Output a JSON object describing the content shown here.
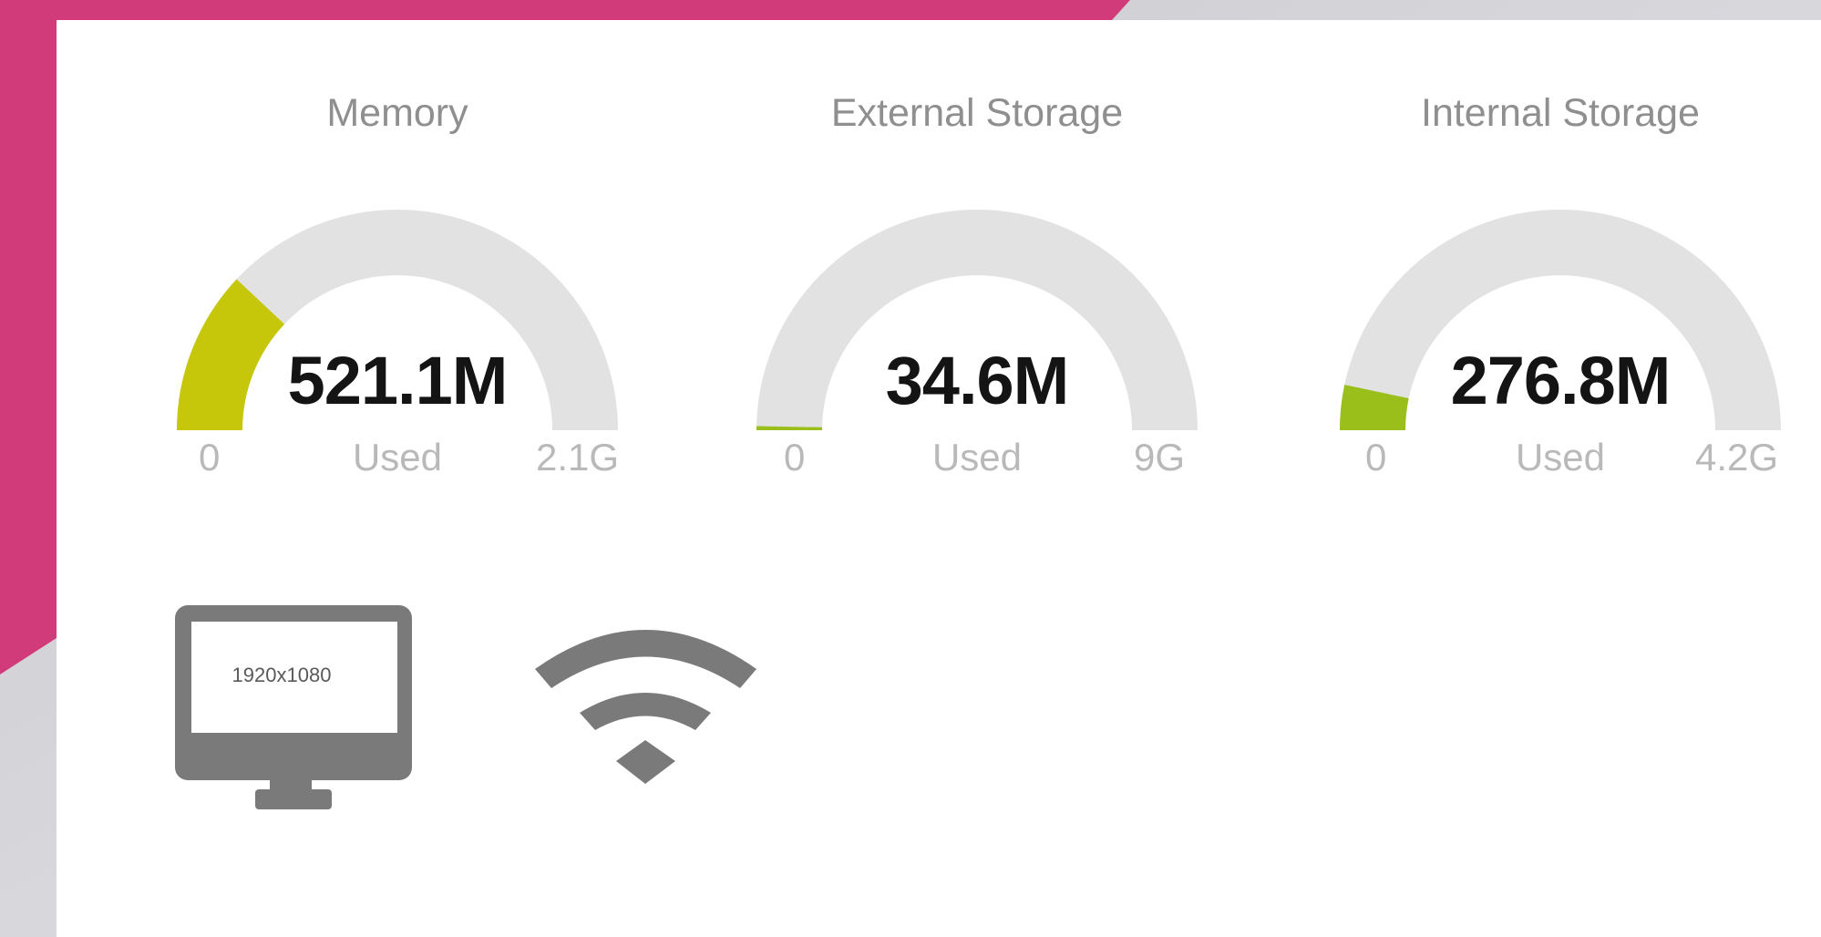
{
  "gauges": [
    {
      "title": "Memory",
      "value": "521.1M",
      "caption": "Used",
      "min": "0",
      "max": "2.1G",
      "fraction": 0.24,
      "fill_color": "#c6c60a"
    },
    {
      "title": "External Storage",
      "value": "34.6M",
      "caption": "Used",
      "min": "0",
      "max": "9G",
      "fraction": 0.004,
      "fill_color": "#9bbf1a"
    },
    {
      "title": "Internal Storage",
      "value": "276.8M",
      "caption": "Used",
      "min": "0",
      "max": "4.2G",
      "fraction": 0.066,
      "fill_color": "#9bbf1a"
    }
  ],
  "display": {
    "resolution": "1920x1080",
    "icon": "monitor-icon"
  },
  "network": {
    "icon": "wifi-icon"
  },
  "colors": {
    "accent": "#d23b7a",
    "track": "#e2e2e2",
    "icon": "#7a7a7a"
  }
}
